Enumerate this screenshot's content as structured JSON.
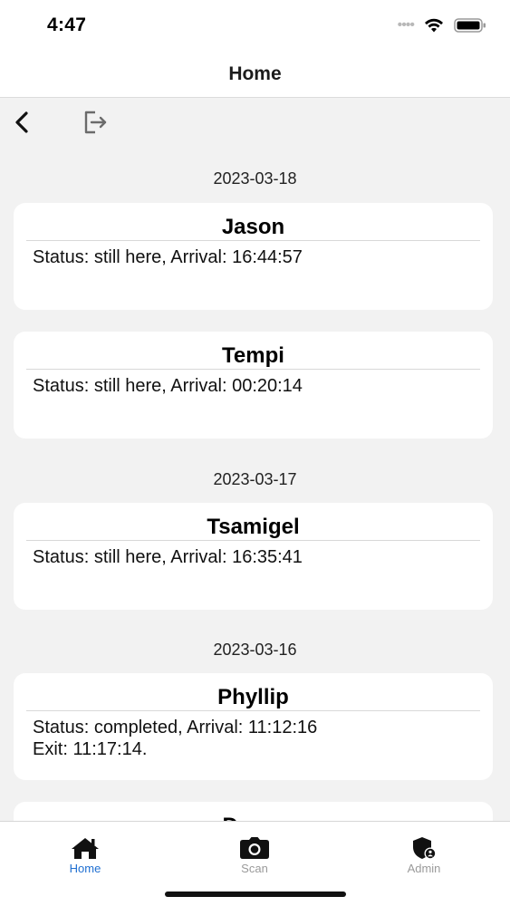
{
  "status_bar": {
    "time": "4:47"
  },
  "header": {
    "title": "Home"
  },
  "sections": [
    {
      "date": "2023-03-18",
      "entries": [
        {
          "name": "Jason",
          "status": "Status: still here,  Arrival: 16:44:57"
        },
        {
          "name": "Tempi",
          "status": "Status: still here,  Arrival: 00:20:14"
        }
      ]
    },
    {
      "date": "2023-03-17",
      "entries": [
        {
          "name": "Tsamigel",
          "status": "Status: still here,  Arrival: 16:35:41"
        }
      ]
    },
    {
      "date": "2023-03-16",
      "entries": [
        {
          "name": "Phyllip",
          "status": "Status: completed, Arrival: 11:12:16\nExit: 11:17:14."
        },
        {
          "name": "Daura",
          "status": ""
        }
      ]
    }
  ],
  "tabs": [
    {
      "label": "Home",
      "icon": "home-icon",
      "active": true
    },
    {
      "label": "Scan",
      "icon": "camera-icon",
      "active": false
    },
    {
      "label": "Admin",
      "icon": "admin-shield-icon",
      "active": false
    }
  ],
  "colors": {
    "accent": "#1f6fd1",
    "inactive_tab": "#9a9a9a",
    "background": "#f2f2f2",
    "card": "#ffffff"
  }
}
